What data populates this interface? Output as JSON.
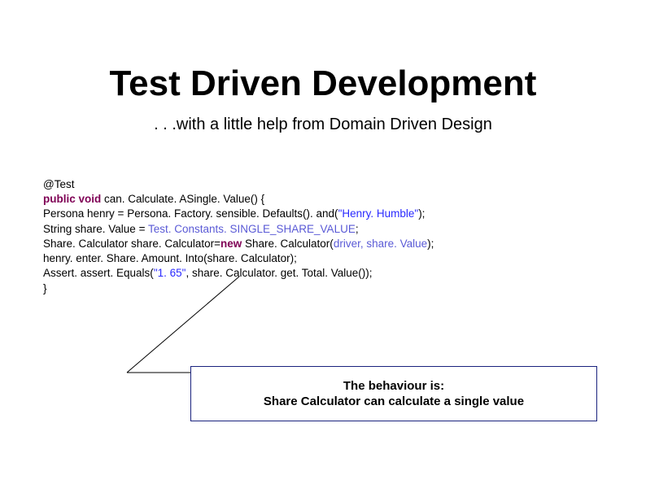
{
  "title": "Test Driven Development",
  "subtitle": ". . .with a little help from Domain Driven Design",
  "code": {
    "line1": "@Test",
    "line2_kw": "public void",
    "line2_rest": " can. Calculate. ASingle. Value() {",
    "line3_a": "Persona henry = Persona. Factory. sensible. Defaults(). and(",
    "line3_str": "\"Henry. Humble\"",
    "line3_b": ");",
    "line4_a": "String share. Value = ",
    "line4_id": "Test. Constants. SINGLE_SHARE_VALUE",
    "line4_b": ";",
    "line5_a": "Share. Calculator share. Calculator=",
    "line5_kw": "new",
    "line5_b": " Share. Calculator(",
    "line5_id": "driver, share. Value",
    "line5_c": ");",
    "line6": "henry. enter. Share. Amount. Into(share. Calculator);",
    "line7_a": "Assert. assert. Equals(",
    "line7_str": "\"1. 65\"",
    "line7_b": ", share. Calculator. get. Total. Value());",
    "line8": "}"
  },
  "box": {
    "line1": "The behaviour is:",
    "line2": "Share Calculator can calculate a single value"
  }
}
